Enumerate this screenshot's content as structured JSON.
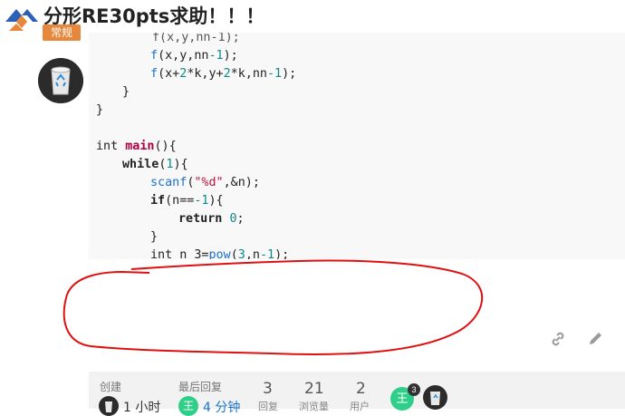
{
  "header": {
    "title": "分形RE30pts求助！！！",
    "category": "常规"
  },
  "code": {
    "lines": [
      "    f(x,y,nn-1);",
      "    f(x+2*k,y+2*k,nn-1);",
      "  }",
      "}",
      "",
      "int main(){",
      "  while(1){",
      "    scanf(\"%d\",&n);",
      "    if(n==-1){",
      "      return 0;",
      "    }",
      "    int n 3=pow(3,n-1);"
    ]
  },
  "icons": {
    "link": "link-icon",
    "edit": "pencil-icon"
  },
  "topic_map": {
    "created_label": "创建",
    "created_value": "1 小时",
    "last_reply_label": "最后回复",
    "last_reply_value": "4 分钟",
    "last_reply_avatar_text": "王",
    "replies_count": "3",
    "replies_label": "回复",
    "views_count": "21",
    "views_label": "浏览量",
    "users_count": "2",
    "users_label": "用户",
    "participant_avatar_text": "王",
    "participant_badge": "3"
  },
  "colors": {
    "tag": "#e8863a",
    "code_bg": "#f8f8f8",
    "red_ink": "#e01010",
    "green_avatar": "#2fcf8a"
  }
}
